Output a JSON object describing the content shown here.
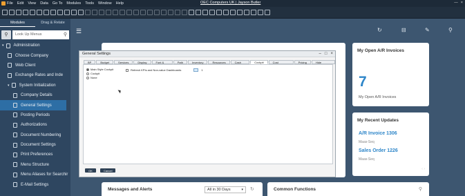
{
  "menubar": {
    "items": [
      "File",
      "Edit",
      "View",
      "Data",
      "Go To",
      "Modules",
      "Tools",
      "Window",
      "Help"
    ],
    "title": "OEC Computers UK | Jayson Butler",
    "window_controls": [
      "—",
      "×"
    ]
  },
  "sidebar": {
    "tabs": [
      "Modules",
      "Drag & Relate"
    ],
    "search_placeholder": "Look Up Menus",
    "items": [
      {
        "label": "Administration",
        "level": 0,
        "arrow": "▾"
      },
      {
        "label": "Choose Company",
        "level": 1
      },
      {
        "label": "Web Client",
        "level": 1
      },
      {
        "label": "Exchange Rates and Inde",
        "level": 1
      },
      {
        "label": "System Initialization",
        "level": 1,
        "arrow": "▾"
      },
      {
        "label": "Company Details",
        "level": 2
      },
      {
        "label": "General Settings",
        "level": 2,
        "active": true
      },
      {
        "label": "Posting Periods",
        "level": 2
      },
      {
        "label": "Authorizations",
        "level": 2
      },
      {
        "label": "Document Numbering",
        "level": 2
      },
      {
        "label": "Document Settings",
        "level": 2
      },
      {
        "label": "Print Preferences",
        "level": 2
      },
      {
        "label": "Menu Structure",
        "level": 2
      },
      {
        "label": "Menu Aliases for Searchir",
        "level": 2
      },
      {
        "label": "E-Mail Settings",
        "level": 2
      }
    ]
  },
  "cards": {
    "ar_invoices": {
      "title": "My Open A/R Invoices",
      "count": "7",
      "subtitle": "My Open A/R Invoices"
    },
    "recent_updates": {
      "title": "My Recent Updates",
      "items": [
        {
          "link": "A/R Invoice 1306",
          "meta": "Maas-Seq"
        },
        {
          "link": "Sales Order 1226",
          "meta": "Maas-Seq"
        }
      ]
    },
    "messages": {
      "title": "Messages and Alerts",
      "range": "All in 30 Days"
    },
    "common": {
      "title": "Common Functions"
    }
  },
  "dialog": {
    "title": "General Settings",
    "tabs": [
      "BP",
      "Budget",
      "Services",
      "Display",
      "Font & Bkgd",
      "Path",
      "Inventory",
      "Resources",
      "Cash Flow",
      "Cockpit",
      "Cost Accounting",
      "Pricing",
      "Hide Functions"
    ],
    "active_tab": "Cockpit",
    "options": [
      "Main Style Cockpit",
      "Cockpit",
      "None"
    ],
    "refresh_label": "Refresh KPIs and Non-value Dashboards",
    "refresh_value": "1",
    "ok_label": "OK",
    "cancel_label": "Cancel"
  }
}
